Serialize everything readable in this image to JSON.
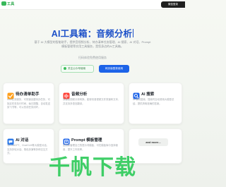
{
  "header": {
    "logo_text": "工具",
    "login_label": "微信登录"
  },
  "hero": {
    "title": "AI工具箱：音频分析",
    "description": "基于 AI 大模型的智能助手，提供音视频分析、待办清单任务管理、AI 搜索、AI 对话、Prompt 模板管理等实用工具服务，是您身边的AI工具箱。",
    "subtitle": "扫码体验免费使用服务",
    "follow_button": "关注公众号使用",
    "primary_button": "网页版登录使用"
  },
  "tools": [
    {
      "title": "待办清单助手",
      "icon": "checklist-icon",
      "color": "#ff9500",
      "desc": "todo任务服务，可快速创建待办任务，可指定任务执行时间，每日提醒，自动发送到飞书等，可以形成任务闭环。"
    },
    {
      "title": "音频分析",
      "icon": "audio-wave-icon",
      "color": "#ff3b30",
      "desc": "快速音视频分析转换，能够将音视频文件快速转文本，并支持多语言翻译。"
    },
    {
      "title": "AI 搜索",
      "icon": "search-icon",
      "color": "#1d63e8",
      "desc": "AI 联网搜索，搜索时自动调用大模型总结，提供清晰准确的答案。"
    },
    {
      "title": "AI 对话",
      "icon": "chat-bubble-icon",
      "color": "#2f7be8",
      "desc": "与ChatGPT、ChatGLM等大模型对话，支持多轮对话、角色扮演等多种交互方式。"
    },
    {
      "title": "Prompt 模板管理",
      "icon": "template-icon",
      "color": "#1d63e8",
      "desc": "定制和管理自己的提示词模板，可在模板库中选择使用，提升工作效率。"
    }
  ],
  "more_label": "and more...",
  "watermark": "千帆下载"
}
